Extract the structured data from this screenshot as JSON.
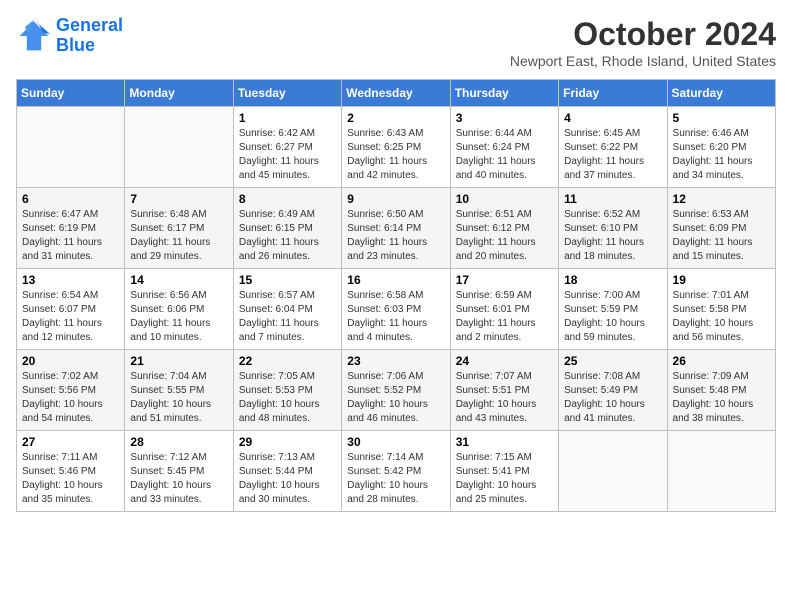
{
  "logo": {
    "line1": "General",
    "line2": "Blue"
  },
  "title": "October 2024",
  "location": "Newport East, Rhode Island, United States",
  "weekdays": [
    "Sunday",
    "Monday",
    "Tuesday",
    "Wednesday",
    "Thursday",
    "Friday",
    "Saturday"
  ],
  "weeks": [
    [
      {
        "day": "",
        "info": ""
      },
      {
        "day": "",
        "info": ""
      },
      {
        "day": "1",
        "info": "Sunrise: 6:42 AM\nSunset: 6:27 PM\nDaylight: 11 hours and 45 minutes."
      },
      {
        "day": "2",
        "info": "Sunrise: 6:43 AM\nSunset: 6:25 PM\nDaylight: 11 hours and 42 minutes."
      },
      {
        "day": "3",
        "info": "Sunrise: 6:44 AM\nSunset: 6:24 PM\nDaylight: 11 hours and 40 minutes."
      },
      {
        "day": "4",
        "info": "Sunrise: 6:45 AM\nSunset: 6:22 PM\nDaylight: 11 hours and 37 minutes."
      },
      {
        "day": "5",
        "info": "Sunrise: 6:46 AM\nSunset: 6:20 PM\nDaylight: 11 hours and 34 minutes."
      }
    ],
    [
      {
        "day": "6",
        "info": "Sunrise: 6:47 AM\nSunset: 6:19 PM\nDaylight: 11 hours and 31 minutes."
      },
      {
        "day": "7",
        "info": "Sunrise: 6:48 AM\nSunset: 6:17 PM\nDaylight: 11 hours and 29 minutes."
      },
      {
        "day": "8",
        "info": "Sunrise: 6:49 AM\nSunset: 6:15 PM\nDaylight: 11 hours and 26 minutes."
      },
      {
        "day": "9",
        "info": "Sunrise: 6:50 AM\nSunset: 6:14 PM\nDaylight: 11 hours and 23 minutes."
      },
      {
        "day": "10",
        "info": "Sunrise: 6:51 AM\nSunset: 6:12 PM\nDaylight: 11 hours and 20 minutes."
      },
      {
        "day": "11",
        "info": "Sunrise: 6:52 AM\nSunset: 6:10 PM\nDaylight: 11 hours and 18 minutes."
      },
      {
        "day": "12",
        "info": "Sunrise: 6:53 AM\nSunset: 6:09 PM\nDaylight: 11 hours and 15 minutes."
      }
    ],
    [
      {
        "day": "13",
        "info": "Sunrise: 6:54 AM\nSunset: 6:07 PM\nDaylight: 11 hours and 12 minutes."
      },
      {
        "day": "14",
        "info": "Sunrise: 6:56 AM\nSunset: 6:06 PM\nDaylight: 11 hours and 10 minutes."
      },
      {
        "day": "15",
        "info": "Sunrise: 6:57 AM\nSunset: 6:04 PM\nDaylight: 11 hours and 7 minutes."
      },
      {
        "day": "16",
        "info": "Sunrise: 6:58 AM\nSunset: 6:03 PM\nDaylight: 11 hours and 4 minutes."
      },
      {
        "day": "17",
        "info": "Sunrise: 6:59 AM\nSunset: 6:01 PM\nDaylight: 11 hours and 2 minutes."
      },
      {
        "day": "18",
        "info": "Sunrise: 7:00 AM\nSunset: 5:59 PM\nDaylight: 10 hours and 59 minutes."
      },
      {
        "day": "19",
        "info": "Sunrise: 7:01 AM\nSunset: 5:58 PM\nDaylight: 10 hours and 56 minutes."
      }
    ],
    [
      {
        "day": "20",
        "info": "Sunrise: 7:02 AM\nSunset: 5:56 PM\nDaylight: 10 hours and 54 minutes."
      },
      {
        "day": "21",
        "info": "Sunrise: 7:04 AM\nSunset: 5:55 PM\nDaylight: 10 hours and 51 minutes."
      },
      {
        "day": "22",
        "info": "Sunrise: 7:05 AM\nSunset: 5:53 PM\nDaylight: 10 hours and 48 minutes."
      },
      {
        "day": "23",
        "info": "Sunrise: 7:06 AM\nSunset: 5:52 PM\nDaylight: 10 hours and 46 minutes."
      },
      {
        "day": "24",
        "info": "Sunrise: 7:07 AM\nSunset: 5:51 PM\nDaylight: 10 hours and 43 minutes."
      },
      {
        "day": "25",
        "info": "Sunrise: 7:08 AM\nSunset: 5:49 PM\nDaylight: 10 hours and 41 minutes."
      },
      {
        "day": "26",
        "info": "Sunrise: 7:09 AM\nSunset: 5:48 PM\nDaylight: 10 hours and 38 minutes."
      }
    ],
    [
      {
        "day": "27",
        "info": "Sunrise: 7:11 AM\nSunset: 5:46 PM\nDaylight: 10 hours and 35 minutes."
      },
      {
        "day": "28",
        "info": "Sunrise: 7:12 AM\nSunset: 5:45 PM\nDaylight: 10 hours and 33 minutes."
      },
      {
        "day": "29",
        "info": "Sunrise: 7:13 AM\nSunset: 5:44 PM\nDaylight: 10 hours and 30 minutes."
      },
      {
        "day": "30",
        "info": "Sunrise: 7:14 AM\nSunset: 5:42 PM\nDaylight: 10 hours and 28 minutes."
      },
      {
        "day": "31",
        "info": "Sunrise: 7:15 AM\nSunset: 5:41 PM\nDaylight: 10 hours and 25 minutes."
      },
      {
        "day": "",
        "info": ""
      },
      {
        "day": "",
        "info": ""
      }
    ]
  ]
}
